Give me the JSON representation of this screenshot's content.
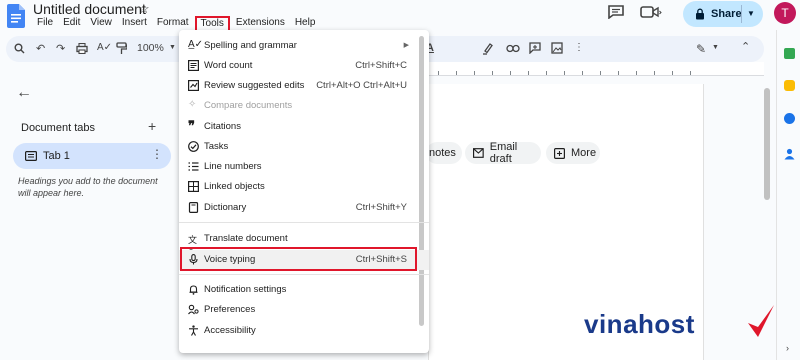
{
  "app": {
    "title": "Untitled document",
    "menus": [
      "File",
      "Edit",
      "View",
      "Insert",
      "Format",
      "Tools",
      "Extensions",
      "Help"
    ],
    "share_label": "Share",
    "avatar_initial": "T"
  },
  "toolbar": {
    "zoom": "100%"
  },
  "left_panel": {
    "heading": "Document tabs",
    "tab_label": "Tab 1",
    "hint": "Headings you add to the document will appear here."
  },
  "chips": {
    "notes": "notes",
    "email": "Email draft",
    "more": "More"
  },
  "tools_menu": {
    "items": [
      {
        "label": "Spelling and grammar",
        "shortcut": ""
      },
      {
        "label": "Word count",
        "shortcut": "Ctrl+Shift+C"
      },
      {
        "label": "Review suggested edits",
        "shortcut": "Ctrl+Alt+O Ctrl+Alt+U"
      },
      {
        "label": "Compare documents",
        "shortcut": ""
      },
      {
        "label": "Citations",
        "shortcut": ""
      },
      {
        "label": "Tasks",
        "shortcut": ""
      },
      {
        "label": "Line numbers",
        "shortcut": ""
      },
      {
        "label": "Linked objects",
        "shortcut": ""
      },
      {
        "label": "Dictionary",
        "shortcut": "Ctrl+Shift+Y"
      },
      {
        "label": "Translate document",
        "shortcut": ""
      },
      {
        "label": "Voice typing",
        "shortcut": "Ctrl+Shift+S"
      },
      {
        "label": "Notification settings",
        "shortcut": ""
      },
      {
        "label": "Preferences",
        "shortcut": ""
      },
      {
        "label": "Accessibility",
        "shortcut": ""
      }
    ]
  },
  "watermark": "vinahost",
  "colors": {
    "highlight": "#e0162b",
    "share_bg": "#c2e7ff",
    "tab_active": "#d3e3fd",
    "avatar": "#c2185b",
    "brand_blue": "#1a3a8a"
  }
}
